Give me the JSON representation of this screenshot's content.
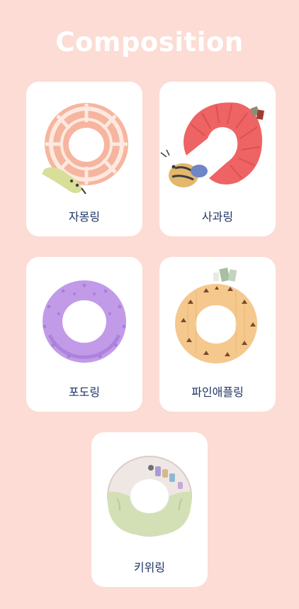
{
  "page": {
    "title": "Composition",
    "background": "#fcdcd4"
  },
  "products": [
    {
      "name": "자몽링",
      "image": "grapefruit-ring-icon",
      "color": "#f6b59f"
    },
    {
      "name": "사과링",
      "image": "apple-ring-icon",
      "color": "#ee6363"
    },
    {
      "name": "포도링",
      "image": "grape-ring-icon",
      "color": "#c19be8"
    },
    {
      "name": "파인애플링",
      "image": "pineapple-ring-icon",
      "color": "#f5c88d"
    },
    {
      "name": "키위링",
      "image": "kiwi-ring-icon",
      "color": "#d3e0b6"
    }
  ]
}
